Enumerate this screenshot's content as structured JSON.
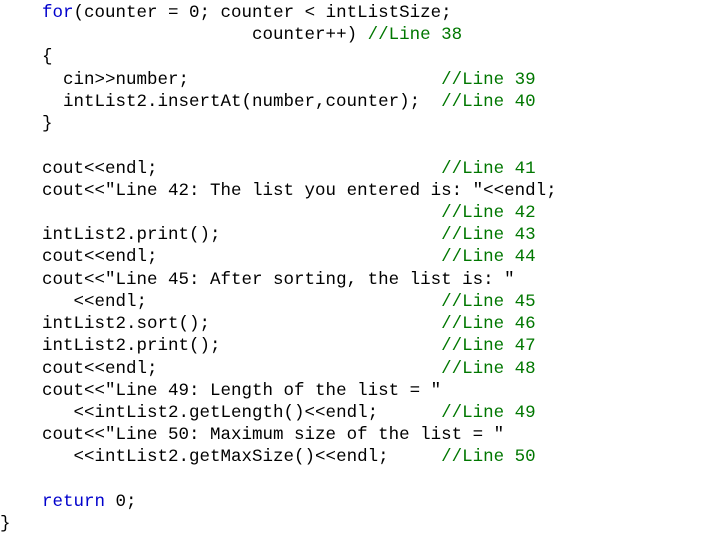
{
  "code": {
    "indent1": "    ",
    "indent2": "      ",
    "indent3": "        ",
    "l1a": "for",
    "l1b": "(counter = 0; counter < intListSize;",
    "l2a": "                    counter++) ",
    "l2b": "//Line 38",
    "l3": "{",
    "l4a": "cin>>number;                        ",
    "l4b": "//Line 39",
    "l5a": "intList2.insertAt(number,counter);  ",
    "l5b": "//Line 40",
    "l6": "}",
    "l7a": "cout<<endl;                           ",
    "l7b": "//Line 41",
    "l8": "cout<<\"Line 42: The list you entered is: \"<<endl;",
    "l9a": "                                      ",
    "l9b": "//Line 42",
    "l10a": "intList2.print();                     ",
    "l10b": "//Line 43",
    "l11a": "cout<<endl;                           ",
    "l11b": "//Line 44",
    "l12": "cout<<\"Line 45: After sorting, the list is: \"",
    "l13a": "   <<endl;                            ",
    "l13b": "//Line 45",
    "l14a": "intList2.sort();                      ",
    "l14b": "//Line 46",
    "l15a": "intList2.print();                     ",
    "l15b": "//Line 47",
    "l16a": "cout<<endl;                           ",
    "l16b": "//Line 48",
    "l17": "cout<<\"Line 49: Length of the list = \"",
    "l18a": "   <<intList2.getLength()<<endl;      ",
    "l18b": "//Line 49",
    "l19": "cout<<\"Line 50: Maximum size of the list = \"",
    "l20a": "   <<intList2.getMaxSize()<<endl;     ",
    "l20b": "//Line 50",
    "l21a": "return",
    "l21b": " 0;",
    "l22": "}"
  }
}
